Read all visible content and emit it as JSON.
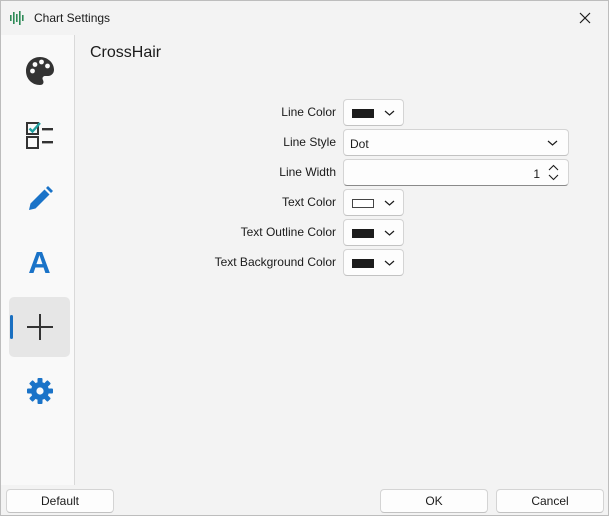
{
  "window": {
    "title": "Chart Settings"
  },
  "icons": {
    "app": "waveform-icon",
    "close": "close-icon"
  },
  "sidebar": {
    "accent": "#1a6fc0",
    "items": [
      {
        "icon": "palette-icon",
        "active": false
      },
      {
        "icon": "checklist-icon",
        "active": false
      },
      {
        "icon": "pencil-icon",
        "active": false
      },
      {
        "icon": "text-icon",
        "glyph": "A",
        "active": false
      },
      {
        "icon": "crosshair-icon",
        "active": true
      },
      {
        "icon": "gear-icon",
        "active": false
      }
    ]
  },
  "section": {
    "title": "CrossHair"
  },
  "form": {
    "line_color_label": "Line Color",
    "line_color": "#1b1b1b",
    "line_style_label": "Line Style",
    "line_style_value": "Dot",
    "line_width_label": "Line Width",
    "line_width_value": "1",
    "text_color_label": "Text Color",
    "text_color": "#ffffff",
    "text_outline_color_label": "Text Outline Color",
    "text_outline_color": "#1b1b1b",
    "text_background_color_label": "Text Background Color",
    "text_background_color": "#1b1b1b"
  },
  "footer": {
    "default_label": "Default",
    "ok_label": "OK",
    "cancel_label": "Cancel"
  }
}
